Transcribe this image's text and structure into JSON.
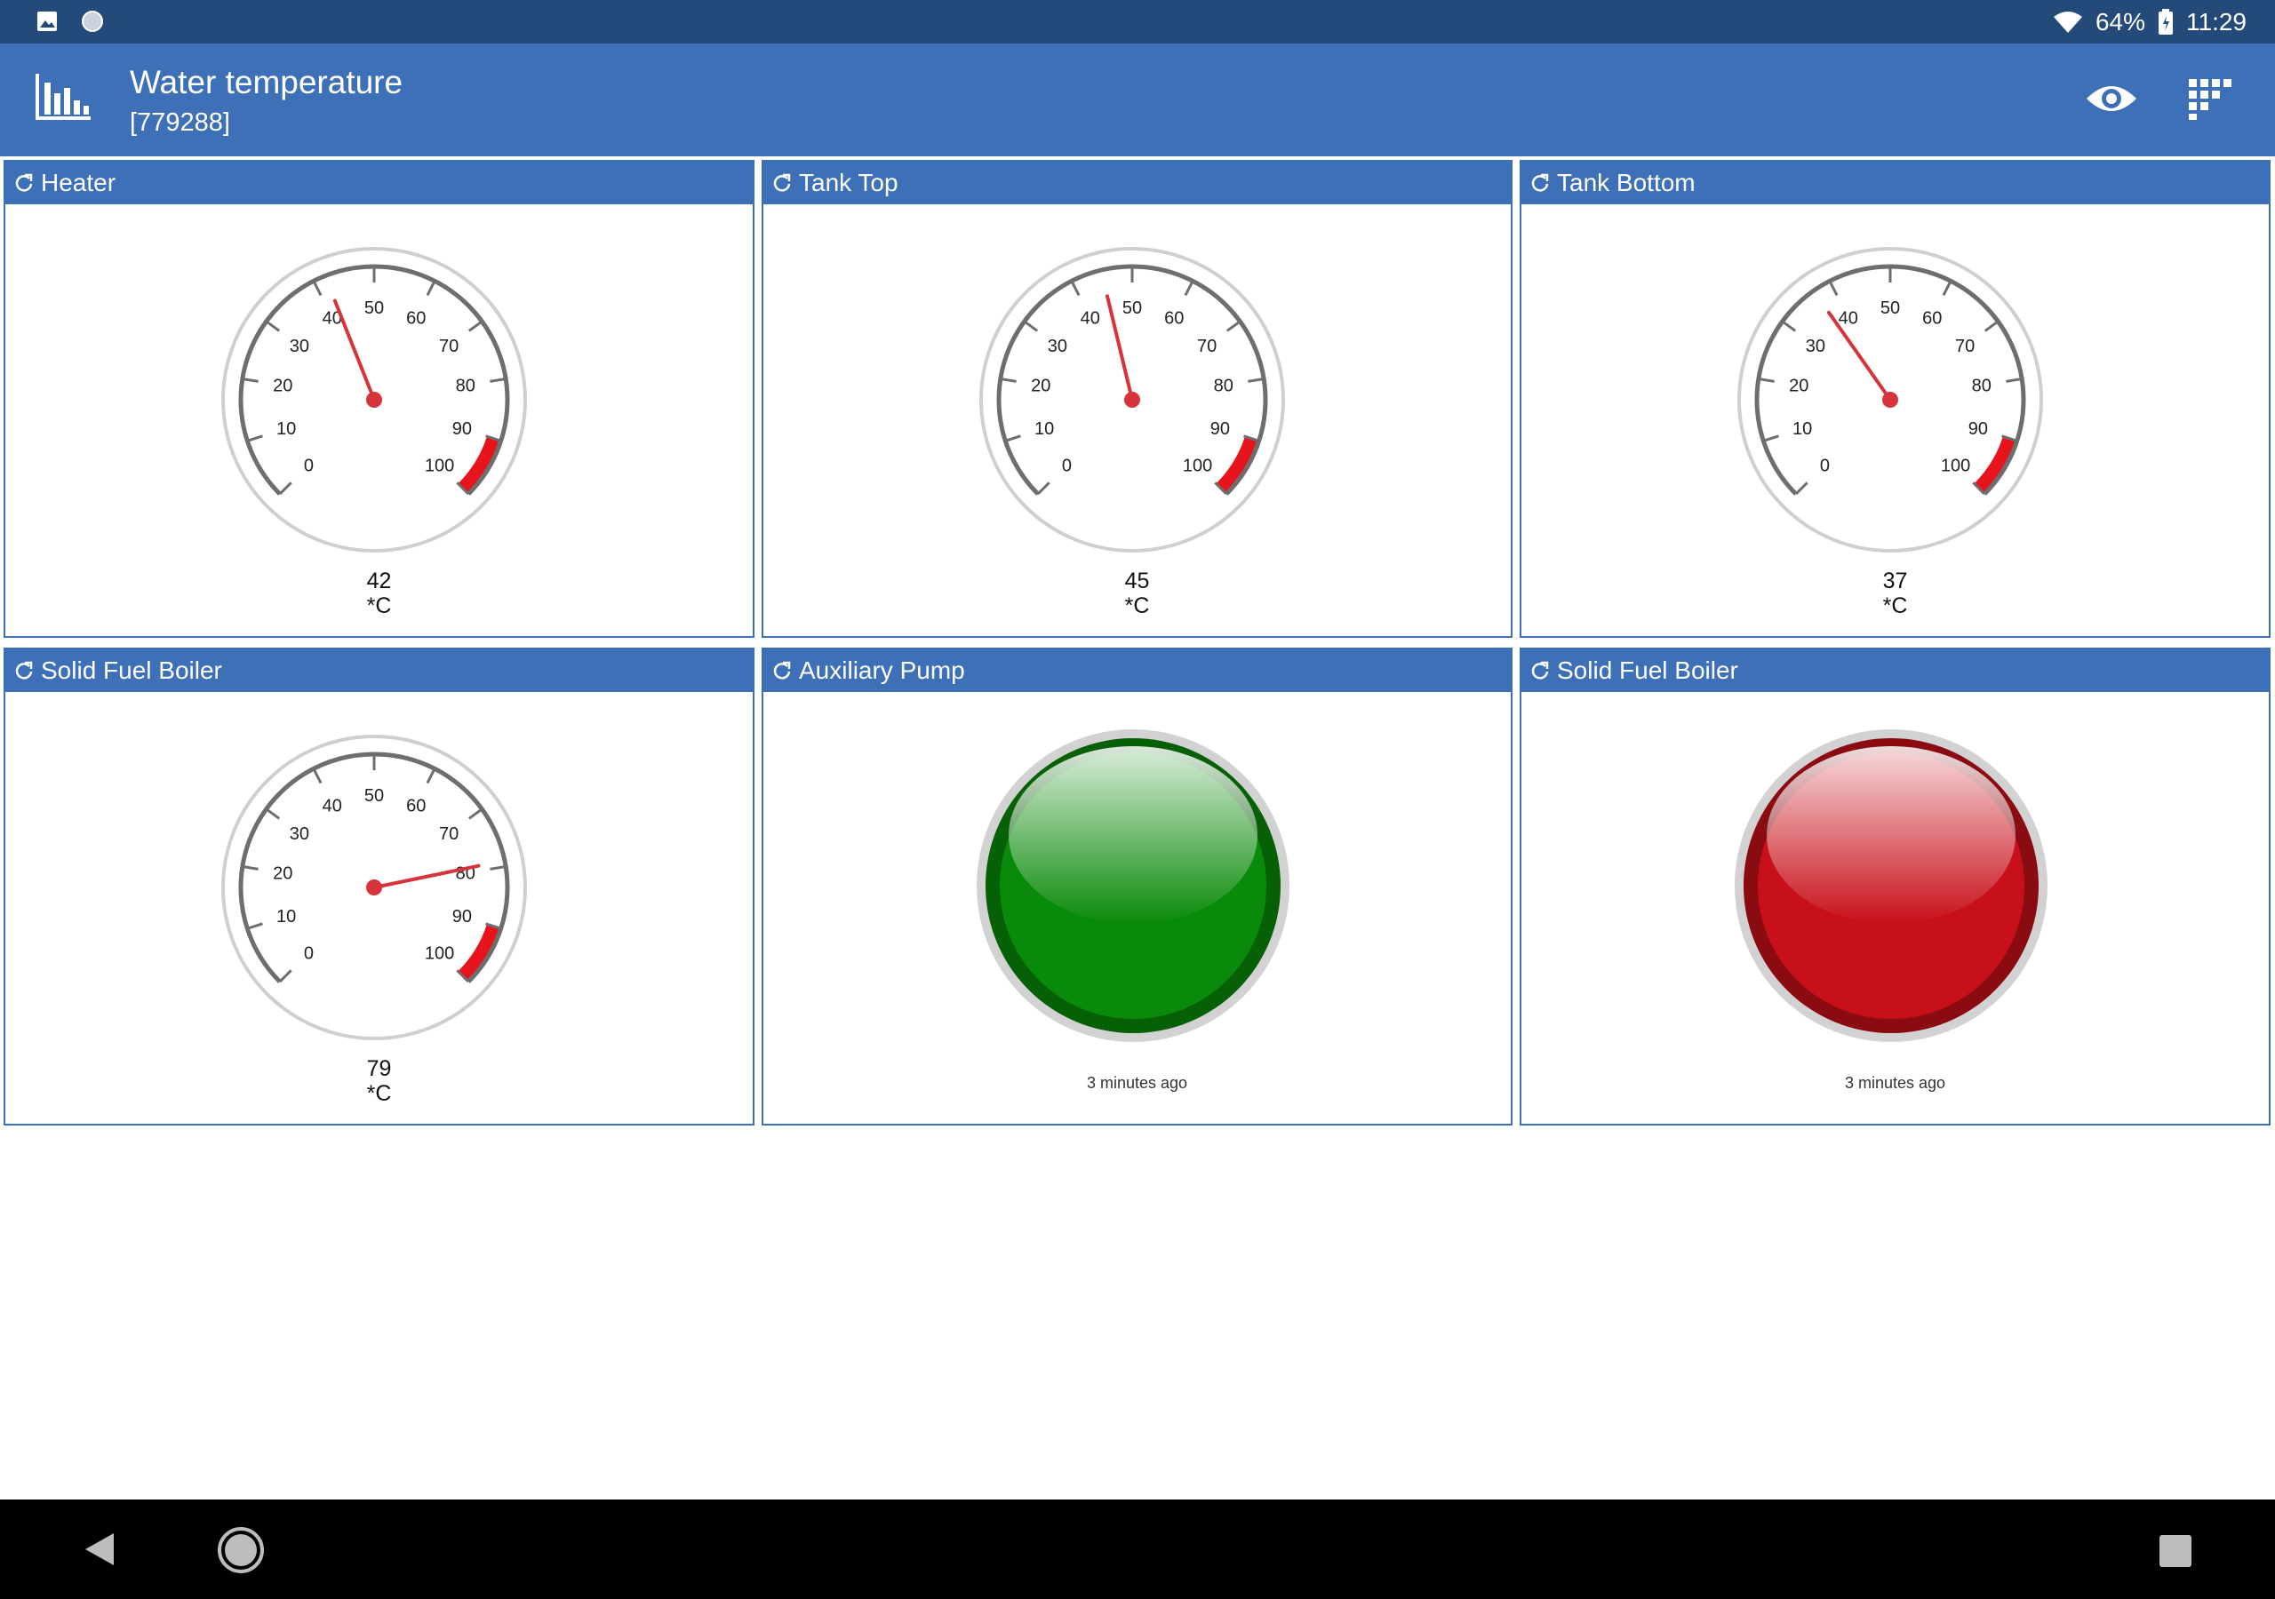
{
  "status_bar": {
    "battery": "64%",
    "time": "11:29"
  },
  "app_bar": {
    "title": "Water temperature",
    "subtitle": "[779288]"
  },
  "gauge_scale": {
    "ticks": [
      "0",
      "10",
      "20",
      "30",
      "40",
      "50",
      "60",
      "70",
      "80",
      "90",
      "100"
    ],
    "min": 0,
    "max": 100,
    "red_zone_from": 90
  },
  "panels": [
    {
      "title": "Heater",
      "kind": "gauge",
      "value": "42",
      "unit": "*C"
    },
    {
      "title": "Tank Top",
      "kind": "gauge",
      "value": "45",
      "unit": "*C"
    },
    {
      "title": "Tank Bottom",
      "kind": "gauge",
      "value": "37",
      "unit": "*C"
    },
    {
      "title": "Solid Fuel Boiler",
      "kind": "gauge",
      "value": "79",
      "unit": "*C"
    },
    {
      "title": "Auxiliary Pump",
      "kind": "lamp",
      "color": "#0a8a0a",
      "updated": "3 minutes ago"
    },
    {
      "title": "Solid Fuel Boiler",
      "kind": "lamp",
      "color": "#c8101a",
      "updated": "3 minutes ago"
    }
  ]
}
